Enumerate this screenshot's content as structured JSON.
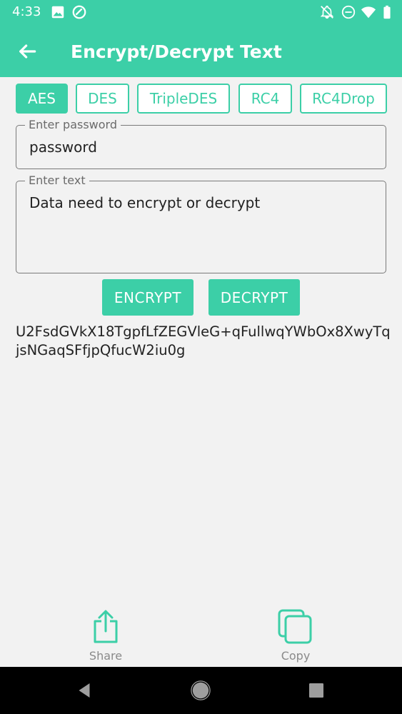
{
  "status_bar": {
    "time": "4:33"
  },
  "toolbar": {
    "title": "Encrypt/Decrypt Text"
  },
  "algorithms": [
    {
      "label": "AES",
      "active": true
    },
    {
      "label": "DES",
      "active": false
    },
    {
      "label": "TripleDES",
      "active": false
    },
    {
      "label": "RC4",
      "active": false
    },
    {
      "label": "RC4Drop",
      "active": false
    }
  ],
  "password_field": {
    "label": "Enter password",
    "value": "password"
  },
  "text_field": {
    "label": "Enter text",
    "value": "Data need to encrypt or decrypt"
  },
  "buttons": {
    "encrypt": "ENCRYPT",
    "decrypt": "DECRYPT"
  },
  "result": {
    "value": "U2FsdGVkX18TgpfLfZEGVleG+qFullwqYWbOx8XwyTqjsNGaqSFfjpQfucW2iu0g"
  },
  "actions": {
    "share": "Share",
    "copy": "Copy"
  },
  "colors": {
    "accent": "#3ccfa7"
  }
}
